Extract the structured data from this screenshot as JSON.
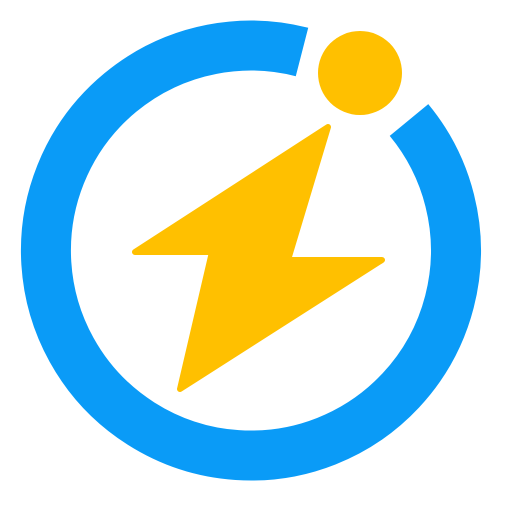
{
  "logo": {
    "name": "lightning-bolt-in-ring-logo",
    "ring_color": "#0A9BF7",
    "accent_color": "#FFC000",
    "background_color": "#FFFFFF"
  }
}
